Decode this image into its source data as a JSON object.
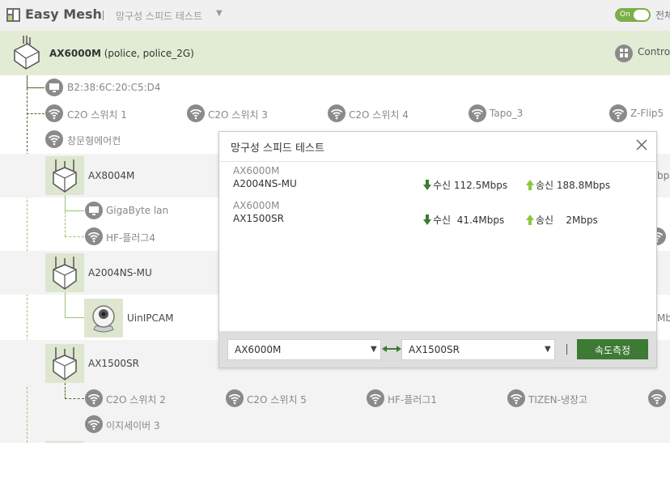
{
  "header": {
    "app_title": "Easy Mesh",
    "menu_label": "망구성 스피드 테스트",
    "menu_caret": "▼",
    "toggle_label": "On",
    "all_label": "전체"
  },
  "main_node": {
    "model": "AX6000M",
    "ssids": "(police, police_2G)",
    "control_label": "Control"
  },
  "wired_client": {
    "label": "B2:38:6C:20:C5:D4"
  },
  "root_clients": [
    {
      "label": "C2O 스위치 1",
      "icon": "wifi-icon"
    },
    {
      "label": "C2O 스위치 3",
      "icon": "wifi-icon"
    },
    {
      "label": "C2O 스위치 4",
      "icon": "wifi-icon"
    },
    {
      "label": "Tapo_3",
      "icon": "wifi-icon"
    },
    {
      "label": "Z-Flip5",
      "icon": "wifi-icon"
    },
    {
      "label": "창문형에어컨",
      "icon": "wifi-icon"
    }
  ],
  "nodes": [
    {
      "model": "AX8004M",
      "edge_text": "bps",
      "clients": [
        {
          "label": "GigaByte lan",
          "icon": "monitor-icon"
        },
        {
          "label": "HF-플러그4",
          "icon": "wifi-icon"
        }
      ]
    },
    {
      "model": "A2004NS-MU",
      "edge_text": "Mbp",
      "clients": [
        {
          "label": "UinIPCAM",
          "icon": "camera-icon"
        }
      ]
    },
    {
      "model": "AX1500SR",
      "clients": [
        {
          "label": "C2O 스위치 2",
          "icon": "wifi-icon"
        },
        {
          "label": "C2O 스위치 5",
          "icon": "wifi-icon"
        },
        {
          "label": "HF-플러그1",
          "icon": "wifi-icon"
        },
        {
          "label": "TIZEN-냉장고",
          "icon": "wifi-icon"
        },
        {
          "label": "이지세이버 3",
          "icon": "wifi-icon"
        }
      ]
    }
  ],
  "modal": {
    "title": "망구성 스피드 테스트",
    "results": [
      {
        "from": "AX6000M",
        "to": "A2004NS-MU",
        "rx": "수신 112.5Mbps",
        "tx": "송신 188.8Mbps"
      },
      {
        "from": "AX6000M",
        "to": "AX1500SR",
        "rx": "수신  41.4Mbps",
        "tx": "송신    2Mbps"
      }
    ],
    "source_select": {
      "value": "AX6000M"
    },
    "target_select": {
      "value": "AX1500SR"
    },
    "measure_button": "속도측정"
  },
  "colors": {
    "accent": "#7cae4a",
    "main_row_bg": "#e2ecd4",
    "button_bg": "#3d7a34",
    "icon_gray": "#8a8a8a"
  }
}
